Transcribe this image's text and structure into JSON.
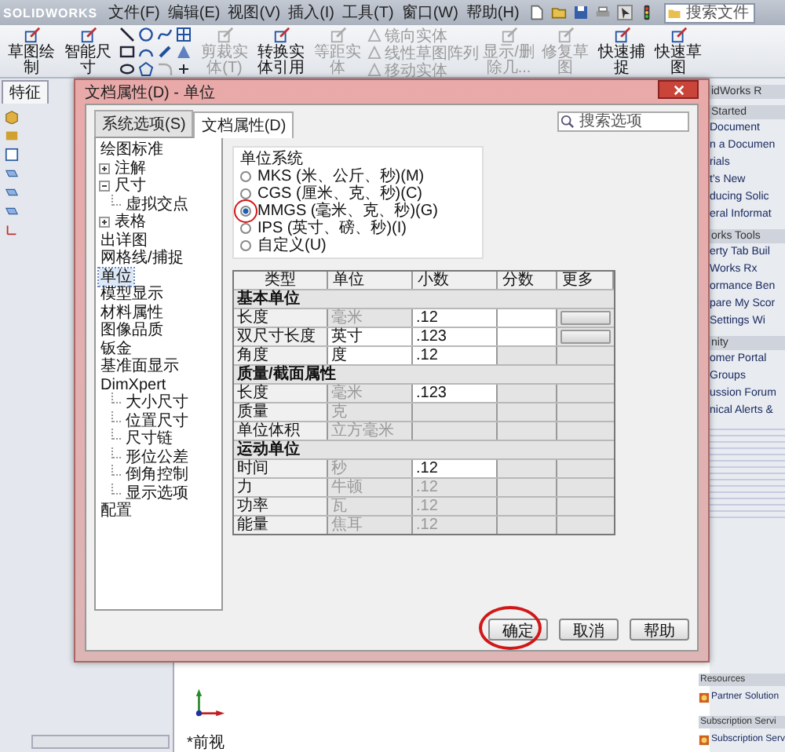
{
  "app": {
    "logo": "SOLIDWORKS",
    "menus": [
      "文件(F)",
      "编辑(E)",
      "视图(V)",
      "插入(I)",
      "工具(T)",
      "窗口(W)",
      "帮助(H)"
    ],
    "search": {
      "placeholder": "搜索文件"
    }
  },
  "ribbon": [
    {
      "kind": "large",
      "label": "草图绘制",
      "disabled": false
    },
    {
      "kind": "large",
      "label": "智能尺寸",
      "disabled": false
    },
    {
      "kind": "grid"
    },
    {
      "kind": "large",
      "label": "剪裁实体(T)",
      "disabled": true
    },
    {
      "kind": "large",
      "label": "转换实体引用",
      "disabled": false
    },
    {
      "kind": "large",
      "label": "等距实体",
      "disabled": true
    },
    {
      "kind": "stack",
      "items": [
        {
          "label": "镜向实体",
          "disabled": true
        },
        {
          "label": "线性草图阵列",
          "disabled": true
        },
        {
          "label": "移动实体",
          "disabled": true
        }
      ]
    },
    {
      "kind": "large",
      "label": "显示/删除几...",
      "disabled": true
    },
    {
      "kind": "large",
      "label": "修复草图",
      "disabled": true
    },
    {
      "kind": "large",
      "label": "快速捕捉",
      "disabled": false
    },
    {
      "kind": "large",
      "label": "快速草图",
      "disabled": false
    }
  ],
  "left_panel": {
    "tabs": [
      {
        "label": "特征",
        "selected": true
      }
    ]
  },
  "task_pane": [
    {
      "kind": "header",
      "text": "idWorks R"
    },
    {
      "kind": "header",
      "text": "Started"
    },
    {
      "kind": "link",
      "text": "Document"
    },
    {
      "kind": "link",
      "text": "n a Documen"
    },
    {
      "kind": "link",
      "text": "rials"
    },
    {
      "kind": "link",
      "text": "t's New"
    },
    {
      "kind": "link",
      "text": "ducing Solic"
    },
    {
      "kind": "link",
      "text": "eral Informat"
    },
    {
      "kind": "header",
      "text": "orks Tools"
    },
    {
      "kind": "link",
      "text": "erty Tab Buil"
    },
    {
      "kind": "link",
      "text": "Works Rx"
    },
    {
      "kind": "link",
      "text": "ormance Ben"
    },
    {
      "kind": "link",
      "text": "pare My Scor"
    },
    {
      "kind": "link",
      "text": "Settings Wi"
    },
    {
      "kind": "header",
      "text": "nity"
    },
    {
      "kind": "link",
      "text": "omer Portal"
    },
    {
      "kind": "link",
      "text": "Groups"
    },
    {
      "kind": "link",
      "text": "ussion Forum"
    },
    {
      "kind": "link",
      "text": "nical Alerts &"
    }
  ],
  "task_pane_bottom": [
    {
      "kind": "header",
      "text": "Resources"
    },
    {
      "kind": "link",
      "text": "Partner Solution"
    },
    {
      "kind": "header",
      "text": "Subscription Servi"
    },
    {
      "kind": "link",
      "text": "Subscription Serv"
    }
  ],
  "graphics": {
    "view_label": "*前视"
  },
  "dialog": {
    "title": "文档属性(D) - 单位",
    "tabs": [
      {
        "label": "系统选项(S)",
        "selected": false
      },
      {
        "label": "文档属性(D)",
        "selected": true
      }
    ],
    "search": {
      "placeholder": "搜索选项"
    },
    "tree": [
      {
        "label": "绘图标准",
        "selected": false
      },
      {
        "label": "注解",
        "selected": false,
        "expanded": false
      },
      {
        "label": "尺寸",
        "selected": false,
        "expanded": true,
        "children": [
          {
            "label": "虚拟交点",
            "selected": false
          }
        ]
      },
      {
        "label": "表格",
        "selected": false,
        "expanded": false
      },
      {
        "label": "出详图",
        "selected": false
      },
      {
        "label": "网格线/捕捉",
        "selected": false
      },
      {
        "label": "单位",
        "selected": true
      },
      {
        "label": "模型显示",
        "selected": false
      },
      {
        "label": "材料属性",
        "selected": false
      },
      {
        "label": "图像品质",
        "selected": false
      },
      {
        "label": "钣金",
        "selected": false
      },
      {
        "label": "基准面显示",
        "selected": false
      },
      {
        "label": "DimXpert",
        "selected": false,
        "children": [
          {
            "label": "大小尺寸",
            "selected": false
          },
          {
            "label": "位置尺寸",
            "selected": false
          },
          {
            "label": "尺寸链",
            "selected": false
          },
          {
            "label": "形位公差",
            "selected": false
          },
          {
            "label": "倒角控制",
            "selected": false
          },
          {
            "label": "显示选项",
            "selected": false
          }
        ]
      },
      {
        "label": "配置",
        "selected": false
      }
    ],
    "unit_system": {
      "title": "单位系统",
      "options": [
        {
          "label": "MKS (米、公斤、秒)(M)",
          "selected": false,
          "circled": false
        },
        {
          "label": "CGS (厘米、克、秒)(C)",
          "selected": false,
          "circled": false
        },
        {
          "label": "MMGS (毫米、克、秒)(G)",
          "selected": true,
          "circled": true
        },
        {
          "label": "IPS (英寸、磅、秒)(I)",
          "selected": false,
          "circled": false
        },
        {
          "label": "自定义(U)",
          "selected": false,
          "circled": false
        }
      ]
    },
    "table": {
      "columns": [
        "类型",
        "单位",
        "小数",
        "分数",
        "更多"
      ],
      "rows": [
        {
          "kind": "section",
          "label": "基本单位"
        },
        {
          "kind": "unit",
          "type": "长度",
          "unit": "毫米",
          "unit_editable": false,
          "decimals": ".12",
          "decimals_editable": true,
          "fraction_editable": true,
          "more_button": true
        },
        {
          "kind": "unit",
          "type": "双尺寸长度",
          "unit": "英寸",
          "unit_editable": true,
          "decimals": ".123",
          "decimals_editable": true,
          "fraction_editable": true,
          "more_button": true
        },
        {
          "kind": "unit",
          "type": "角度",
          "unit": "度",
          "unit_editable": true,
          "decimals": ".12",
          "decimals_editable": true,
          "fraction_editable": false,
          "more_button": false
        },
        {
          "kind": "section",
          "label": "质量/截面属性"
        },
        {
          "kind": "unit",
          "type": "长度",
          "unit": "毫米",
          "unit_editable": false,
          "decimals": ".123",
          "decimals_editable": true,
          "fraction_editable": false,
          "more_button": false
        },
        {
          "kind": "unit",
          "type": "质量",
          "unit": "克",
          "unit_editable": false,
          "decimals_editable": false,
          "fraction_editable": false,
          "more_button": false
        },
        {
          "kind": "unit",
          "type": "单位体积",
          "unit": "立方毫米",
          "unit_editable": false,
          "decimals_editable": false,
          "fraction_editable": false,
          "more_button": false
        },
        {
          "kind": "section",
          "label": "运动单位"
        },
        {
          "kind": "unit",
          "type": "时间",
          "unit": "秒",
          "unit_editable": false,
          "decimals": ".12",
          "decimals_editable": true,
          "fraction_editable": false,
          "more_button": false
        },
        {
          "kind": "unit",
          "type": "力",
          "unit": "牛顿",
          "unit_editable": false,
          "decimals": ".12",
          "decimals_editable": false,
          "fraction_editable": false,
          "more_button": false
        },
        {
          "kind": "unit",
          "type": "功率",
          "unit": "瓦",
          "unit_editable": false,
          "decimals": ".12",
          "decimals_editable": false,
          "fraction_editable": false,
          "more_button": false
        },
        {
          "kind": "unit",
          "type": "能量",
          "unit": "焦耳",
          "unit_editable": false,
          "decimals": ".12",
          "decimals_editable": false,
          "fraction_editable": false,
          "more_button": false
        }
      ]
    },
    "buttons": [
      {
        "label": "确定",
        "circled": true
      },
      {
        "label": "取消",
        "circled": false
      },
      {
        "label": "帮助",
        "circled": false
      }
    ]
  }
}
